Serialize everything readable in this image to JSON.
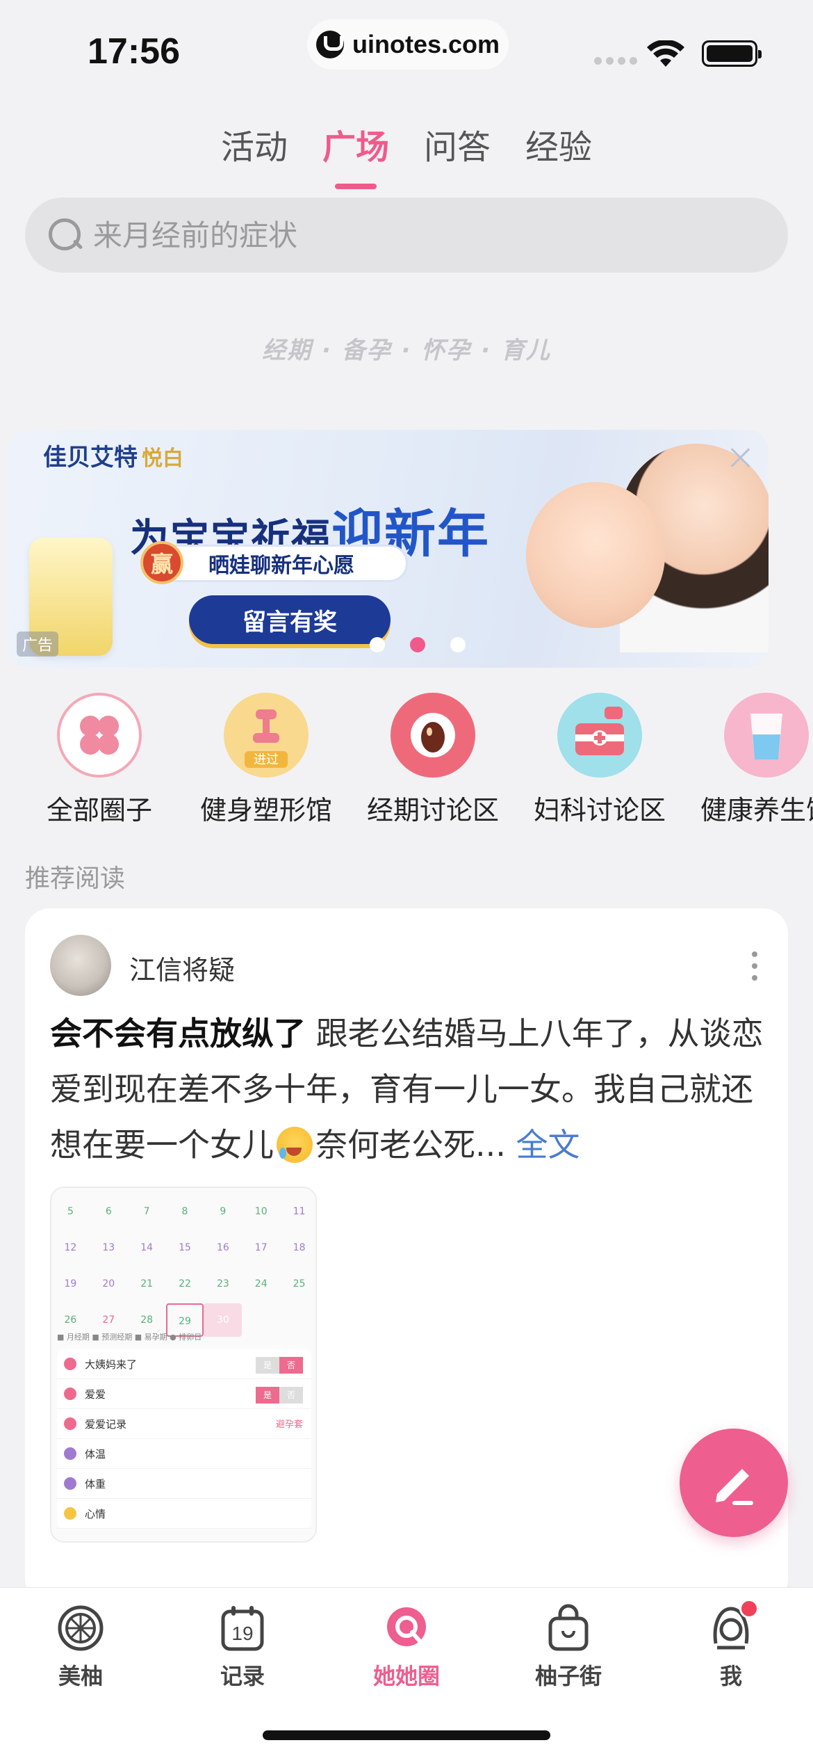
{
  "status_bar": {
    "time": "17:56",
    "url": "uinotes.com"
  },
  "top_tabs": [
    {
      "label": "活动",
      "active": false
    },
    {
      "label": "广场",
      "active": true
    },
    {
      "label": "问答",
      "active": false
    },
    {
      "label": "经验",
      "active": false
    }
  ],
  "search": {
    "placeholder": "来月经前的症状"
  },
  "slogan": "经期 · 备孕 · 怀孕 · 育儿",
  "banner": {
    "brand": "佳贝艾特",
    "brand_sub": "悦白",
    "title_prefix": "为宝宝祈福",
    "title_highlight": "迎新年",
    "badge": "赢",
    "subtitle": "晒娃聊新年心愿",
    "button": "留言有奖",
    "ad_tag": "广告",
    "active_dot": 1
  },
  "circles": [
    {
      "label": "全部圈子",
      "icon": "clover-icon",
      "color": "#f4a8b8"
    },
    {
      "label": "健身塑形馆",
      "icon": "dumbbell-icon",
      "color": "#f8d98e",
      "tag": "进过"
    },
    {
      "label": "经期讨论区",
      "icon": "period-cup-icon",
      "color": "#ee6a7a"
    },
    {
      "label": "妇科讨论区",
      "icon": "medical-kit-icon",
      "color": "#9fe0ea"
    },
    {
      "label": "健康养生馆",
      "icon": "water-glass-icon",
      "color": "#f7b6cc"
    }
  ],
  "section_title": "推荐阅读",
  "post": {
    "author": "江信将疑",
    "title": "会不会有点放纵了",
    "body_1": " 跟老公结婚马上八年了，从谈恋爱到现在差不多十年，育有一儿一女。我自己就还想在要一个女儿",
    "body_2": "奈何老公死...",
    "more_link": "全文",
    "thumbnail": {
      "days": [
        "5",
        "6",
        "7",
        "8",
        "9",
        "10",
        "11",
        "12",
        "13",
        "14",
        "15",
        "16",
        "17",
        "18",
        "19",
        "20",
        "21",
        "22",
        "23",
        "24",
        "25",
        "26",
        "27",
        "28",
        "29",
        "30"
      ],
      "today_label": "29",
      "legend": "■ 月经期  ■ 预测经期  ■ 易孕期  ● 排卵日",
      "rows": [
        {
          "label": "大姨妈来了",
          "on": "是",
          "off": "否"
        },
        {
          "label": "爱爱",
          "on": "是",
          "off": "否"
        },
        {
          "label": "爱爱记录",
          "extra": "避孕套"
        },
        {
          "label": "体温"
        },
        {
          "label": "体重"
        },
        {
          "label": "心情"
        }
      ]
    }
  },
  "bottom_nav": [
    {
      "label": "美柚",
      "icon": "grapefruit-icon",
      "active": false
    },
    {
      "label": "记录",
      "icon": "calendar-icon",
      "active": false,
      "day": "19"
    },
    {
      "label": "她她圈",
      "icon": "chat-bubble-icon",
      "active": true
    },
    {
      "label": "柚子街",
      "icon": "shopping-bag-icon",
      "active": false
    },
    {
      "label": "我",
      "icon": "profile-icon",
      "active": false,
      "badge": true
    }
  ],
  "colors": {
    "accent": "#ee5e8e",
    "background": "#f2f2f4"
  }
}
